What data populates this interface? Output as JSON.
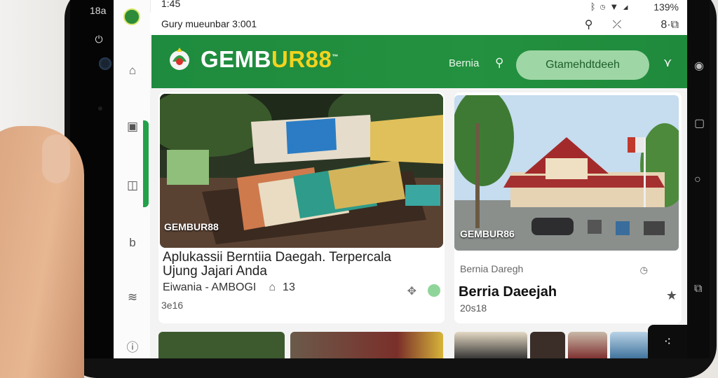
{
  "device": {
    "left_status_text": "18a",
    "left_status_icon": "phone-icon"
  },
  "status_bar": {
    "time": "1:45",
    "battery": "139%",
    "icons": [
      "bluetooth-icon",
      "alarm-icon",
      "wifi-icon",
      "signal-icon"
    ]
  },
  "sub_bar": {
    "title": "Gury mueunbar 3:001",
    "icons": [
      "search-icon",
      "translate-icon",
      "tabs-icon"
    ],
    "tabs_label": "8·"
  },
  "app_bar": {
    "brand_white": "GEMB",
    "brand_yellow": "UR88",
    "brand_tm": "™",
    "link": "Bernia",
    "cta": "Gtamehdtdeeh",
    "colors": {
      "primary": "#1f8a3c",
      "accent": "#f2d31f",
      "pill": "#9fd6a5"
    }
  },
  "nav_rail": {
    "items": [
      "home-icon",
      "media-icon",
      "bookmark-icon",
      "text-icon",
      "layers-icon",
      "info-icon"
    ]
  },
  "main_card": {
    "image_label": "GEMBUR88",
    "title": "Aplukassii Berntiia Daegah. Terpercala Ujung Jajari Anda",
    "source": "Eiwania - AMBOGI",
    "likes": "13",
    "time": "3e16"
  },
  "side_card": {
    "image_label": "GEMBUR86",
    "category": "Bernia Daregh",
    "title": "Berria Daeejah",
    "time": "20s18"
  }
}
